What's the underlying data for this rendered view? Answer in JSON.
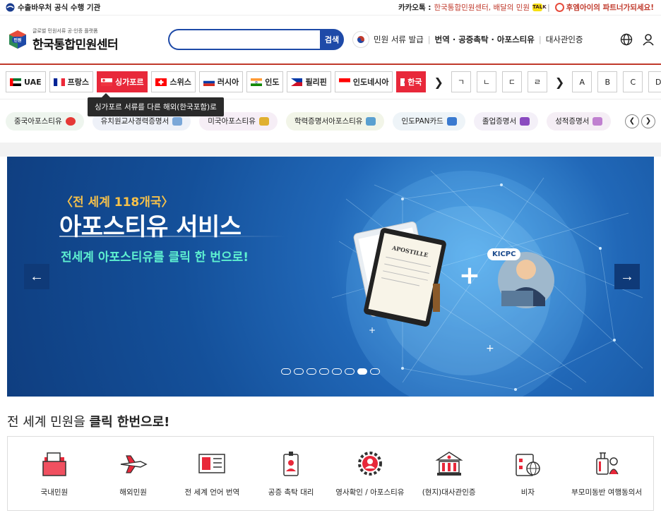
{
  "topbar": {
    "left_text": "수출바우처 공식 수행 기관",
    "kakao_label": "카카오톡 :",
    "kakao_text": "한국통합민원센터, 배달의 민원",
    "partner_text": "후엠아이의 파트너가되세요!"
  },
  "header": {
    "logo_small": "글로벌 민원서류 공·인증 플랫폼",
    "logo_big": "한국통합민원센터",
    "logo_badge": "민원",
    "search_placeholder": "",
    "search_button": "검색",
    "nav": {
      "issue": "민원 서류 발급",
      "translate": "번역 · 공증촉탁 · 아포스티유",
      "embassy": "대사관인증"
    }
  },
  "countries": [
    {
      "label": "UAE",
      "flag": "uae"
    },
    {
      "label": "프랑스",
      "flag": "france"
    },
    {
      "label": "싱가포르",
      "flag": "singapore",
      "active": true
    },
    {
      "label": "스위스",
      "flag": "swiss"
    },
    {
      "label": "러시아",
      "flag": "russia"
    },
    {
      "label": "인도",
      "flag": "india"
    },
    {
      "label": "필리핀",
      "flag": "philippines"
    },
    {
      "label": "인도네시아",
      "flag": "indonesia"
    },
    {
      "label": "한국",
      "flag": "korea"
    }
  ],
  "korean_letters": [
    "ㄱ",
    "ㄴ",
    "ㄷ",
    "ㄹ"
  ],
  "latin_letters": [
    "A",
    "B",
    "C",
    "D"
  ],
  "tooltip": "싱가포르 서류를 다른 해외(한국포함)로",
  "tags": [
    {
      "label": "중국아포스티유",
      "bg": "#eef5ee",
      "icon_color": "#e53935"
    },
    {
      "label": "유치원교사경력증명서",
      "bg": "#eef1f8",
      "icon_color": "#7aa7d8"
    },
    {
      "label": "미국아포스티유",
      "bg": "#f6eef6",
      "icon_color": "#e0b030"
    },
    {
      "label": "학력증명서아포스티유",
      "bg": "#f2f5e8",
      "icon_color": "#5aa0d0"
    },
    {
      "label": "인도PAN카드",
      "bg": "#eef4f8",
      "icon_color": "#3a7ad0"
    },
    {
      "label": "졸업증명서",
      "bg": "#f4f0f8",
      "icon_color": "#8a4ac0"
    },
    {
      "label": "성적증명서",
      "bg": "#f5eef5",
      "icon_color": "#c080d0"
    }
  ],
  "banner": {
    "subtitle": "〈전 세계 118개국〉",
    "title": "아포스티유 서비스",
    "description": "전세계 아포스티유를 클릭 한 번으로!",
    "kicpc": "KICPC",
    "apostille": "APOSTILLE",
    "dots_total": 8,
    "dots_active": 6
  },
  "headline": {
    "prefix": "전 세계 민원을 ",
    "bold": "클릭 한번으로",
    "suffix": "!"
  },
  "services": [
    {
      "label": "국내민원",
      "icon": "folder-icon"
    },
    {
      "label": "해외민원",
      "icon": "airplane-icon"
    },
    {
      "label": "전 세계 언어 번역",
      "icon": "translation-icon"
    },
    {
      "label": "공증 촉탁 대리",
      "icon": "id-badge-icon"
    },
    {
      "label": "영사확인 / 아포스티유",
      "icon": "gear-person-icon"
    },
    {
      "label": "(현지)대사관인증",
      "icon": "embassy-icon"
    },
    {
      "label": "비자",
      "icon": "visa-icon"
    },
    {
      "label": "부모미동반 여행동의서",
      "icon": "luggage-icon"
    }
  ]
}
